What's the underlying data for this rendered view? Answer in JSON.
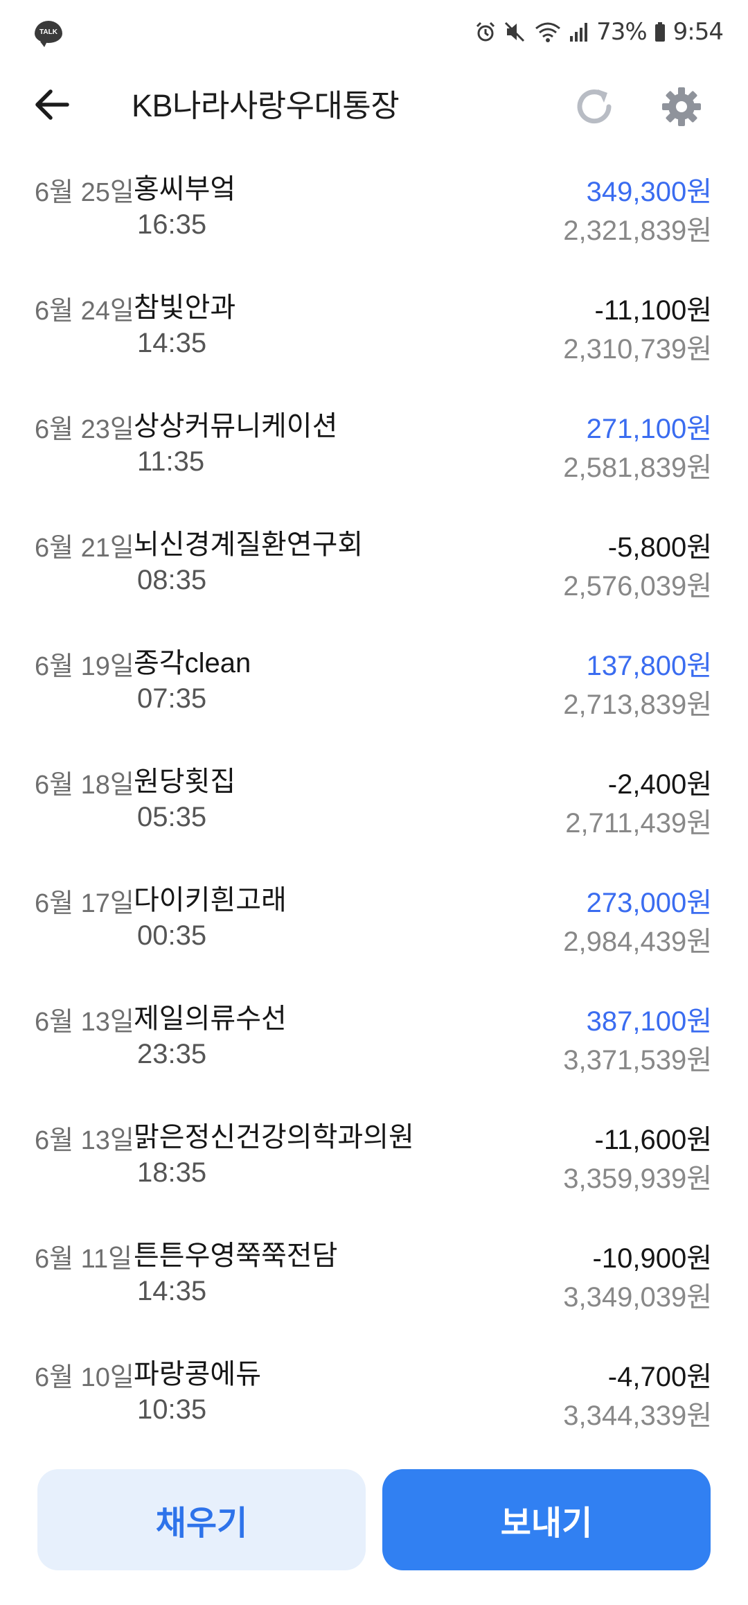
{
  "status_bar": {
    "app_icon_label": "TALK",
    "battery": "73%",
    "time": "9:54"
  },
  "header": {
    "title": "KB나라사랑우대통장",
    "back_icon": "back-arrow-icon",
    "refresh_icon": "refresh-icon",
    "settings_icon": "gear-icon"
  },
  "colors": {
    "deposit": "#3a6cf0",
    "withdrawal": "#161616",
    "balance": "#888888",
    "primary_button": "#3180f2",
    "secondary_button_bg": "#e7f0fc"
  },
  "transactions": [
    {
      "date": "6월 25일",
      "name": "홍씨부엌",
      "time": "16:35",
      "amount": "349,300원",
      "balance": "2,321,839원",
      "type": "in"
    },
    {
      "date": "6월 24일",
      "name": "참빛안과",
      "time": "14:35",
      "amount": "-11,100원",
      "balance": "2,310,739원",
      "type": "out"
    },
    {
      "date": "6월 23일",
      "name": "상상커뮤니케이션",
      "time": "11:35",
      "amount": "271,100원",
      "balance": "2,581,839원",
      "type": "in"
    },
    {
      "date": "6월 21일",
      "name": "뇌신경계질환연구회",
      "time": "08:35",
      "amount": "-5,800원",
      "balance": "2,576,039원",
      "type": "out"
    },
    {
      "date": "6월 19일",
      "name": "종각clean",
      "time": "07:35",
      "amount": "137,800원",
      "balance": "2,713,839원",
      "type": "in"
    },
    {
      "date": "6월 18일",
      "name": "원당횟집",
      "time": "05:35",
      "amount": "-2,400원",
      "balance": "2,711,439원",
      "type": "out"
    },
    {
      "date": "6월 17일",
      "name": "다이키흰고래",
      "time": "00:35",
      "amount": "273,000원",
      "balance": "2,984,439원",
      "type": "in"
    },
    {
      "date": "6월 13일",
      "name": "제일의류수선",
      "time": "23:35",
      "amount": "387,100원",
      "balance": "3,371,539원",
      "type": "in"
    },
    {
      "date": "6월 13일",
      "name": "맑은정신건강의학과의원",
      "time": "18:35",
      "amount": "-11,600원",
      "balance": "3,359,939원",
      "type": "out"
    },
    {
      "date": "6월 11일",
      "name": "튼튼우영쭉쭉전담",
      "time": "14:35",
      "amount": "-10,900원",
      "balance": "3,349,039원",
      "type": "out"
    },
    {
      "date": "6월 10일",
      "name": "파랑콩에듀",
      "time": "10:35",
      "amount": "-4,700원",
      "balance": "3,344,339원",
      "type": "out"
    }
  ],
  "actions": {
    "fill_label": "채우기",
    "send_label": "보내기"
  }
}
